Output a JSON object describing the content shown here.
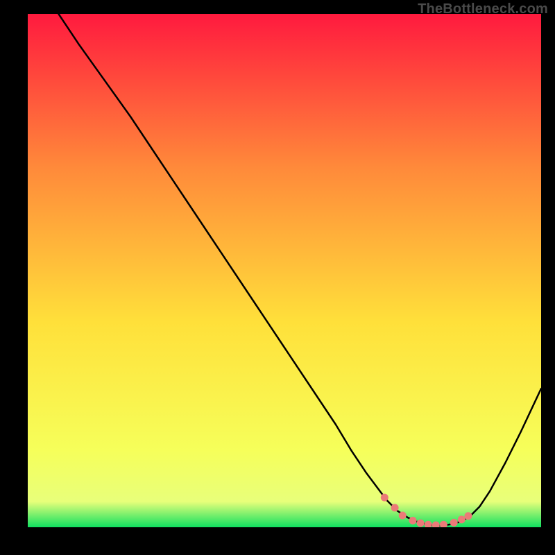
{
  "watermark": "TheBottleneck.com",
  "gradient": {
    "top": "#ff1a3e",
    "upper": "#ff8a3a",
    "mid": "#ffe03a",
    "lower": "#f6ff5a",
    "band": "#e8ff7a",
    "bottom": "#10e060"
  },
  "curve_color": "#000000",
  "marker_color": "#eb7a78",
  "chart_data": {
    "type": "line",
    "title": "",
    "xlabel": "",
    "ylabel": "",
    "xlim": [
      0,
      100
    ],
    "ylim": [
      0,
      100
    ],
    "grid": false,
    "legend": false,
    "series": [
      {
        "name": "bottleneck-curve",
        "x": [
          6,
          10,
          15,
          20,
          25,
          30,
          35,
          40,
          45,
          50,
          55,
          60,
          63,
          66,
          69,
          70,
          72,
          74,
          76,
          78,
          80,
          82,
          84,
          86,
          88,
          90,
          93,
          96,
          100
        ],
        "y": [
          100,
          94,
          87,
          80,
          72.5,
          65,
          57.5,
          50,
          42.5,
          35,
          27.5,
          20,
          15,
          10.5,
          6.5,
          5.2,
          3.2,
          1.9,
          1.0,
          0.5,
          0.3,
          0.5,
          1.0,
          2.0,
          4.0,
          7.0,
          12.5,
          18.5,
          27.0
        ]
      }
    ],
    "markers": {
      "name": "highlight-points",
      "x": [
        69.5,
        71.5,
        73.0,
        75.0,
        76.5,
        78.0,
        79.5,
        81.0,
        83.0,
        84.5,
        85.8
      ],
      "y": [
        5.8,
        3.8,
        2.3,
        1.3,
        0.8,
        0.5,
        0.4,
        0.5,
        0.9,
        1.5,
        2.2
      ]
    }
  }
}
